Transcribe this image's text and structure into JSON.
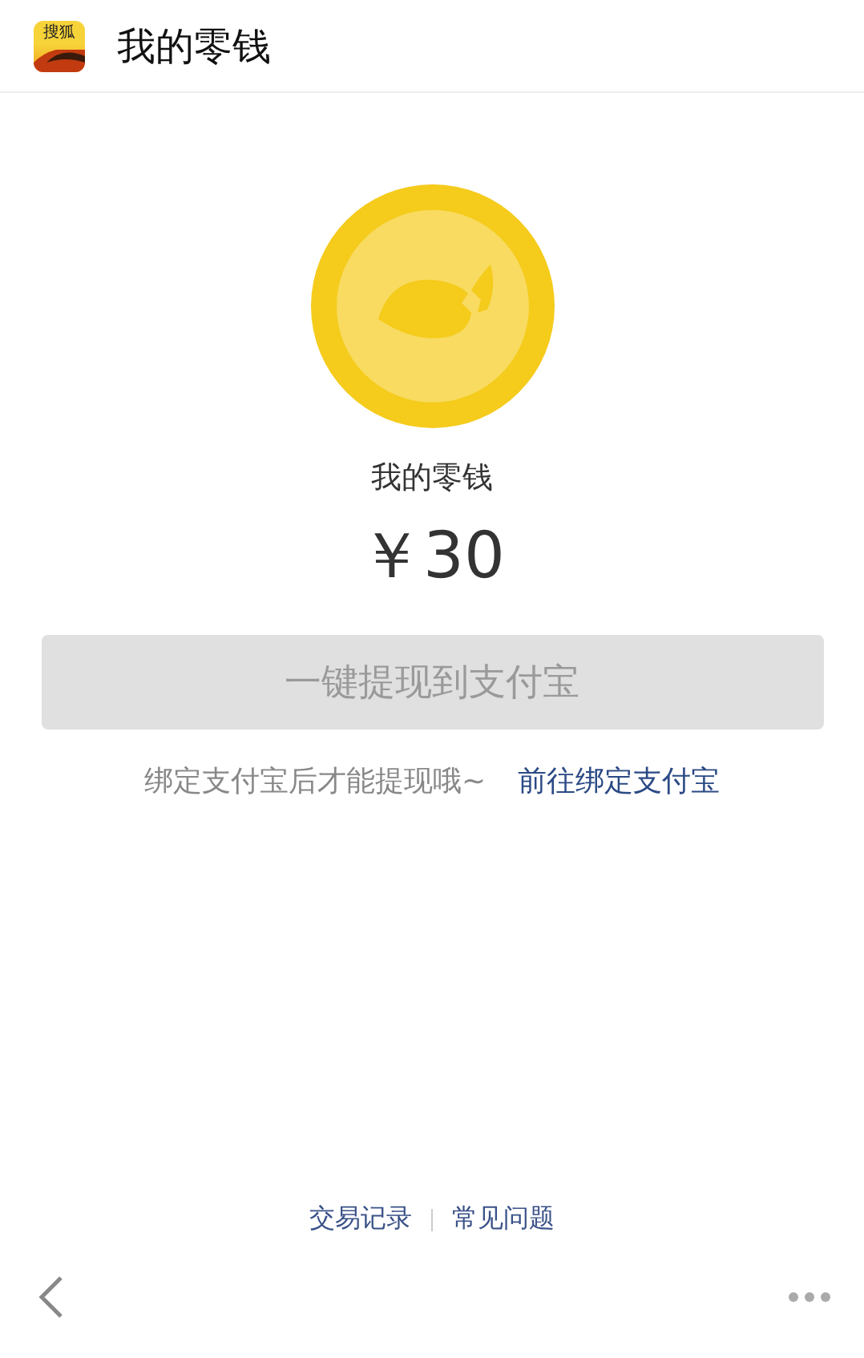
{
  "header": {
    "app_icon_text": "搜狐",
    "title": "我的零钱"
  },
  "balance": {
    "label": "我的零钱",
    "amount": "￥30"
  },
  "withdraw_button": {
    "label": "一键提现到支付宝",
    "disabled": true
  },
  "hint": {
    "text": "绑定支付宝后才能提现哦~",
    "link": "前往绑定支付宝"
  },
  "footer_links": [
    "交易记录",
    "常见问题"
  ]
}
